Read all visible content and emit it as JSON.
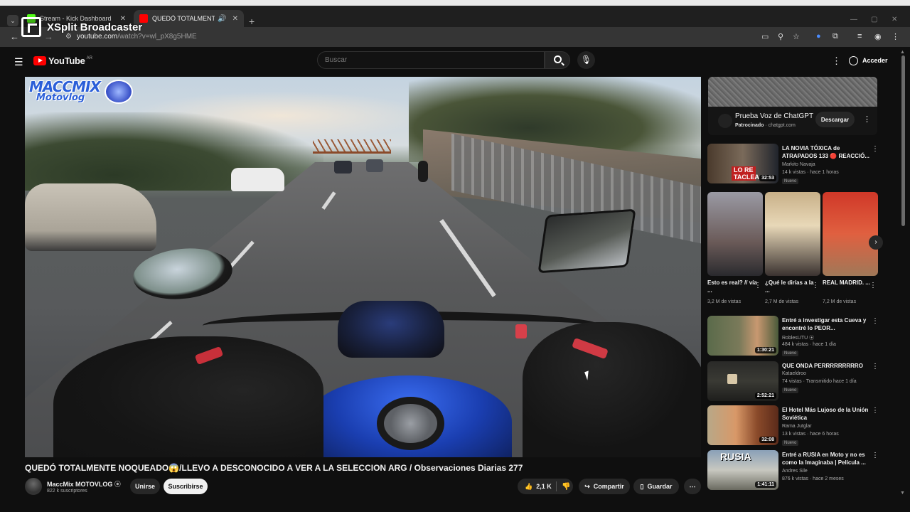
{
  "browser": {
    "top_strip_text": "",
    "tabs": [
      {
        "label": "Stream - Kick Dashboard",
        "favicon_color": "#53fc18"
      },
      {
        "label": "QUEDÓ TOTALMENTE NOQ",
        "favicon_color": "#ff0000"
      }
    ],
    "url_host": "youtube.com",
    "url_path": "/watch?v=wl_pX8g5HME",
    "overlay_brand": "XSplit Broadcaster"
  },
  "yt": {
    "logo_text": "YouTube",
    "logo_region": "AR",
    "search_placeholder": "Buscar",
    "signin_label": "Acceder"
  },
  "video": {
    "watermark_line1": "MACCMIX",
    "watermark_line2": "Motovlog",
    "title": "QUEDÓ TOTALMENTE NOQUEADO😱/LLEVO A DESCONOCIDO A VER A LA SELECCION ARG / Observaciones Diarias 277",
    "channel_name": "MaccMix MOTOVLOG",
    "channel_subs": "822 k suscriptores",
    "join_label": "Unirse",
    "subscribe_label": "Suscribirse",
    "likes": "2,1 K",
    "share_label": "Compartir",
    "save_label": "Guardar"
  },
  "ad": {
    "title": "Prueba Voz de ChatGPT",
    "sponsored": "Patrocinado",
    "domain": "chatgpt.com",
    "cta": "Descargar"
  },
  "recs": [
    {
      "title": "LA NOVIA TÓXICA de ATRAPADOS 133 🔴 REACCIÓ...",
      "channel": "Markito Navaja",
      "meta": "14 k vistas · hace 1 horas",
      "badge": "Nuevo",
      "duration": "32:53",
      "thumb_text": "LO RE TACLEA"
    },
    {
      "title": "Entré a investigar esta Cueva y encontré lo PEOR...",
      "channel": "RoblesUTU",
      "meta": "484 k vistas · hace 1 día",
      "badge": "Nuevo",
      "duration": "1:30:21"
    },
    {
      "title": "QUE ONDA PERRRRRRRRRO",
      "channel": "Kataeldroo",
      "meta": "74 vistas · Transmitido hace 1 día",
      "badge": "Nuevo",
      "duration": "2:52:21"
    },
    {
      "title": "El Hotel Más Lujoso de la Unión Soviética",
      "channel": "Rama Jutglar",
      "meta": "13 k vistas · hace 6 horas",
      "badge": "Nuevo",
      "duration": "32:08"
    },
    {
      "title": "Entré a RUSIA en Moto y no es como la Imaginaba | Película ...",
      "channel": "Andres Sile",
      "meta": "876 k vistas · hace 2 meses",
      "badge": "",
      "duration": "1:41:11",
      "thumb_text": "RUSIA"
    }
  ],
  "shorts": [
    {
      "title": "Esto es real? // vía ...",
      "views": "3,2 M de vistas"
    },
    {
      "title": "¿Qué le dirías a la ...",
      "views": "2,7 M de vistas"
    },
    {
      "title": "REAL MADRID. ...",
      "views": "7,2 M de vistas"
    }
  ]
}
